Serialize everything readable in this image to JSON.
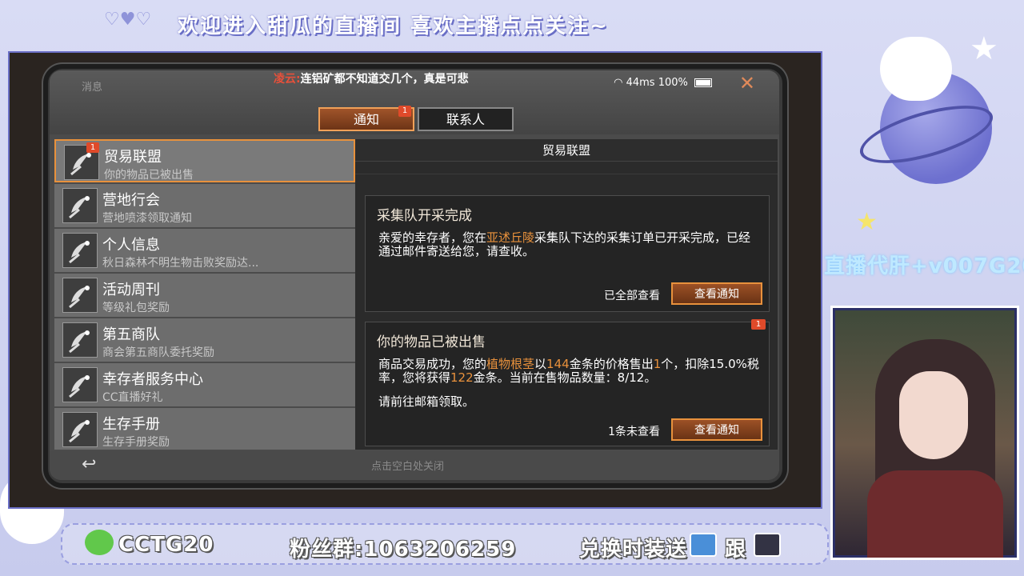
{
  "overlay": {
    "top_banner_hearts": "♡♥♡",
    "top_banner_text": "欢迎进入甜瓜的直播间 喜欢主播点点关注~",
    "watermark_text": "直播代肝+v007G20",
    "bottom": {
      "wechat_id": "CCTG20",
      "fan_group": "粉丝群:1063206259",
      "promo": "兑换时装送",
      "follow": "跟"
    }
  },
  "game": {
    "messages_label": "消息",
    "marquee": {
      "who": "凌云:",
      "text": "连铝矿都不知道交几个，真是可悲"
    },
    "status": {
      "ping": "44ms",
      "battery": "100%"
    },
    "close_glyph": "✕",
    "tabs": [
      {
        "label": "通知",
        "badge": "1"
      },
      {
        "label": "联系人"
      }
    ],
    "list": [
      {
        "title": "贸易联盟",
        "sub": "你的物品已被出售",
        "badge": "1"
      },
      {
        "title": "营地行会",
        "sub": "营地喷漆领取通知"
      },
      {
        "title": "个人信息",
        "sub": "秋日森林不明生物击败奖励达..."
      },
      {
        "title": "活动周刊",
        "sub": "等级礼包奖励"
      },
      {
        "title": "第五商队",
        "sub": "商会第五商队委托奖励"
      },
      {
        "title": "幸存者服务中心",
        "sub": "CC直播好礼"
      },
      {
        "title": "生存手册",
        "sub": "生存手册奖励"
      }
    ],
    "detail": {
      "title": "贸易联盟",
      "card1": {
        "title": "采集队开采完成",
        "body_a": "亲爱的幸存者，您在",
        "body_hl": "亚述丘陵",
        "body_b": "采集队下达的采集订单已开采完成，已经通过邮件寄送给您，请查收。",
        "status": "已全部查看",
        "button": "查看通知"
      },
      "card2": {
        "title": "你的物品已被出售",
        "badge": "1",
        "body_a": "商品交易成功，您的",
        "body_hl1": "植物根茎",
        "body_b": "以",
        "body_hl2": "144",
        "body_c": "金条的价格售出",
        "body_hl3": "1",
        "body_d": "个，扣除15.0%税率，您将获得",
        "body_hl4": "122",
        "body_e": "金条。当前在售物品数量：8/12。",
        "extra": "请前往邮箱领取。",
        "status": "1条未查看",
        "button": "查看通知"
      }
    },
    "back_glyph": "↩",
    "bottom_hint": "点击空白处关闭"
  }
}
